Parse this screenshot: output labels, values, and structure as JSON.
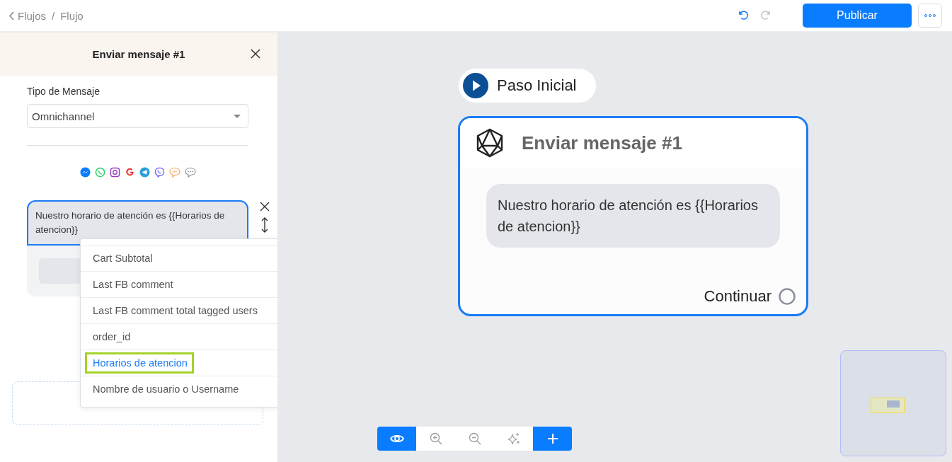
{
  "breadcrumb": {
    "back": "Flujos",
    "separator": "/",
    "current": "Flujo"
  },
  "history": [
    {
      "kind": "undo",
      "disabled": false
    },
    {
      "kind": "redo",
      "disabled": true
    }
  ],
  "publish_button": "Publicar",
  "panel": {
    "title": "Enviar mensaje #1",
    "message_type_label": "Tipo de Mensaje",
    "message_type_value": "Omnichannel",
    "channels": [
      {
        "kind": "messenger"
      },
      {
        "kind": "whatsapp"
      },
      {
        "kind": "instagram"
      },
      {
        "kind": "google"
      },
      {
        "kind": "telegram"
      },
      {
        "kind": "viber"
      },
      {
        "kind": "sms"
      },
      {
        "kind": "chat"
      }
    ],
    "message_text": "Nuestro horario de atención es {{Horarios de atencion}}",
    "variable_menu": [
      {
        "label": "Cart Subtotal",
        "selected": false
      },
      {
        "label": "Last FB comment",
        "selected": false
      },
      {
        "label": "Last FB comment total tagged users",
        "selected": false
      },
      {
        "label": "order_id",
        "selected": false
      },
      {
        "label": "Horarios de atencion",
        "selected": true
      },
      {
        "label": "Nombre de usuario o Username",
        "selected": false
      }
    ]
  },
  "canvas": {
    "start_node": {
      "label": "Paso Inicial"
    },
    "message_node": {
      "title": "Enviar mensaje #1",
      "text": "Nuestro horario de atención es {{Horarios de atencion}}",
      "next_label": "Continuar",
      "selected": true
    },
    "controls": [
      {
        "kind": "preview"
      },
      {
        "kind": "zoom-in"
      },
      {
        "kind": "zoom-out"
      },
      {
        "kind": "auto-arrange"
      },
      {
        "kind": "add"
      }
    ]
  }
}
